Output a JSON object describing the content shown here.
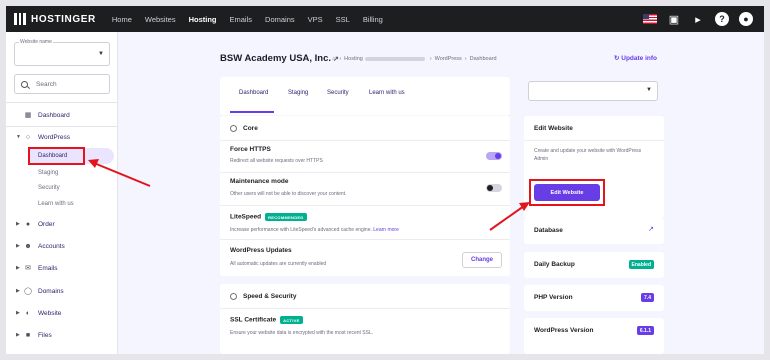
{
  "topbar": {
    "brand": "HOSTINGER",
    "nav": [
      "Home",
      "Websites",
      "Hosting",
      "Emails",
      "Domains",
      "VPS",
      "SSL",
      "Billing"
    ],
    "active_nav": "Hosting"
  },
  "sidebar": {
    "website_name_label": "Website name",
    "search_placeholder": "Search",
    "items": {
      "dashboard": "Dashboard",
      "wordpress": "WordPress",
      "order": "Order",
      "accounts": "Accounts",
      "emails": "Emails",
      "domains": "Domains",
      "website": "Website",
      "files": "Files"
    },
    "wp_sub": [
      "Dashboard",
      "Staging",
      "Security",
      "Learn with us"
    ]
  },
  "header": {
    "site_title": "BSW Academy USA, Inc.",
    "breadcrumb_hosting": "Hosting",
    "breadcrumb_wordpress": "WordPress",
    "breadcrumb_dashboard": "Dashboard",
    "update_info": "Update info"
  },
  "tabs": [
    "Dashboard",
    "Staging",
    "Security",
    "Learn with us"
  ],
  "core": {
    "title": "Core",
    "force_https": {
      "title": "Force HTTPS",
      "desc": "Redirect all website requests over HTTPS",
      "on": true
    },
    "maintenance": {
      "title": "Maintenance mode",
      "desc": "Other users will not be able to discover your content.",
      "on": false
    },
    "litespeed": {
      "title": "LiteSpeed",
      "badge": "RECOMMENDED",
      "desc": "Increase performance with LiteSpeed's advanced cache engine.",
      "link": "Learn more"
    },
    "wp_updates": {
      "title": "WordPress Updates",
      "desc": "All automatic updates are currently enabled",
      "button": "Change"
    }
  },
  "security": {
    "title": "Speed & Security",
    "ssl_title": "SSL Certificate",
    "ssl_badge": "ACTIVE",
    "ssl_desc": "Ensure your website data is encrypted with the most recent SSL."
  },
  "edit_website": {
    "title": "Edit Website",
    "desc": "Create and update your website with WordPress Admin",
    "button": "Edit Website"
  },
  "side_cards": {
    "database": "Database",
    "daily_backup": "Daily Backup",
    "daily_backup_badge": "Enabled",
    "php_version": "PHP Version",
    "php_value": "7.4",
    "wp_version": "WordPress Version",
    "wp_value": "6.1.1"
  },
  "colors": {
    "accent": "#673de6",
    "highlight": "#e3141b",
    "success": "#00b090",
    "topbar": "#1d1e20"
  }
}
